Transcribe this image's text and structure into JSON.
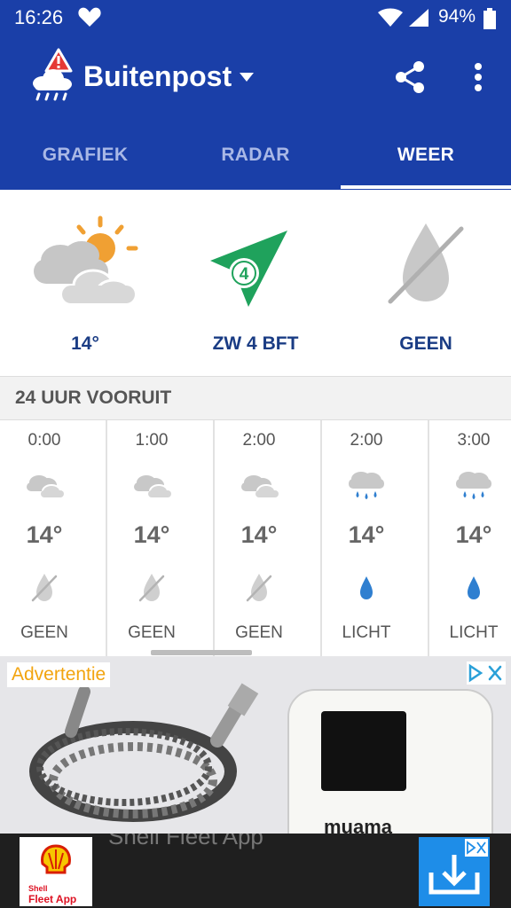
{
  "status_bar": {
    "time": "16:26",
    "battery_percent": "94%",
    "icons": [
      "heart-icon",
      "wifi-icon",
      "signal-icon",
      "battery-icon"
    ]
  },
  "app_bar": {
    "title": "Buitenpost",
    "icons": [
      "weather-alert-logo-icon",
      "dropdown-arrow-icon",
      "share-icon",
      "more-vert-icon"
    ]
  },
  "tabs": [
    {
      "label": "GRAFIEK",
      "active": false
    },
    {
      "label": "RADAR",
      "active": false
    },
    {
      "label": "WEER",
      "active": true
    }
  ],
  "current": {
    "temperature": "14°",
    "wind": "ZW 4 BFT",
    "wind_force": "4",
    "precipitation": "GEEN",
    "icons": [
      "partly-cloudy-sun-icon",
      "wind-direction-arrow-icon",
      "no-rain-drop-icon"
    ]
  },
  "forecast": {
    "heading": "24 UUR VOORUIT",
    "hours": [
      {
        "time": "0:00",
        "temp": "14°",
        "precip": "GEEN",
        "icon": "cloud-icon",
        "precip_icon": "no-rain-drop-icon"
      },
      {
        "time": "1:00",
        "temp": "14°",
        "precip": "GEEN",
        "icon": "cloud-icon",
        "precip_icon": "no-rain-drop-icon"
      },
      {
        "time": "2:00",
        "temp": "14°",
        "precip": "GEEN",
        "icon": "cloud-icon",
        "precip_icon": "no-rain-drop-icon"
      },
      {
        "time": "2:00",
        "temp": "14°",
        "precip": "LICHT",
        "icon": "rain-cloud-icon",
        "precip_icon": "rain-drop-icon"
      },
      {
        "time": "3:00",
        "temp": "14°",
        "precip": "LICHT",
        "icon": "rain-cloud-icon",
        "precip_icon": "rain-drop-icon"
      }
    ]
  },
  "ad": {
    "label": "Advertentie",
    "brand": "muama"
  },
  "banner": {
    "title": "Shell Fleet App",
    "logo_text_1": "Shell",
    "logo_text_2": "Fleet App"
  },
  "colors": {
    "primary": "#1a3fa8",
    "text_dark_blue": "#1a3c84",
    "wind_green": "#1fa25c",
    "rain_blue": "#2f7fd0",
    "sun_orange": "#f0a033",
    "ad_label": "#f2a40f"
  }
}
